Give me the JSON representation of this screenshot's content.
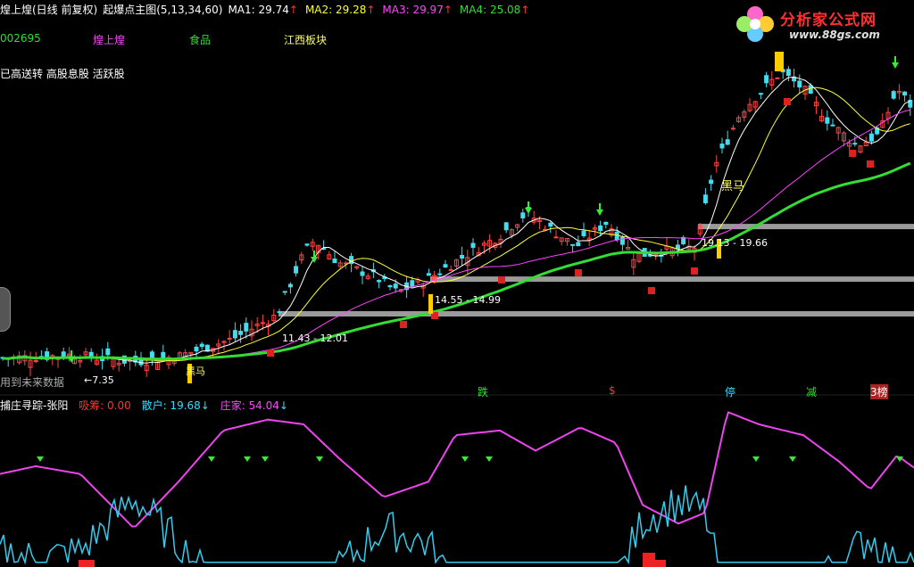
{
  "header": {
    "title": "煌上煌(日线 前复权)",
    "indicator": "起爆点主图(5,13,34,60)",
    "ma1": "MA1: 29.74",
    "ma2": "MA2: 29.28",
    "ma3": "MA3: 29.97",
    "ma4": "MA4: 25.08",
    "ma1_color": "#ffffff",
    "ma2_color": "#ffff33",
    "ma3_color": "#ff44ff",
    "ma4_color": "#33dd33"
  },
  "info": {
    "code": "002695",
    "name": "煌上煌",
    "industry": "食品",
    "region": "江西板块",
    "tags": "已高送转 高股息股 活跃股"
  },
  "logo": {
    "text": "分析家公式网",
    "url": "www.88gs.com"
  },
  "sub_header": {
    "title": "捕庄寻踪-张阳",
    "s1": "吸筹: 0.00",
    "s2": "散户: 19.68",
    "s3": "庄家: 54.04",
    "s1_color": "#ff3333",
    "s2_color": "#33ddff",
    "s3_color": "#ff44ff"
  },
  "annotations": {
    "future": "用到未来数据",
    "low_price": "←7.35",
    "heima1": "黑马",
    "heima2": "黑马",
    "range1": "11.43 - 12.01",
    "range2": "14.55 - 14.99",
    "range3": "19.13 - 19.66",
    "sig_die": "跌",
    "sig_s": "$",
    "sig_ting": "停",
    "sig_jian": "减",
    "sig_bang": "3榜"
  },
  "chart_data": [
    {
      "type": "candlestick",
      "name": "main",
      "ylim": [
        6,
        35
      ],
      "ma_lines": [
        "MA1",
        "MA2",
        "MA3",
        "MA4"
      ],
      "ma_last": [
        29.74,
        29.28,
        29.97,
        25.08
      ],
      "support_levels": [
        {
          "low": 11.43,
          "high": 12.01
        },
        {
          "low": 14.55,
          "high": 14.99
        },
        {
          "low": 19.13,
          "high": 19.66
        }
      ],
      "low_marker": 7.35
    },
    {
      "type": "line",
      "name": "sub",
      "series": [
        {
          "name": "散户",
          "last": 19.68
        },
        {
          "name": "庄家",
          "last": 54.04
        },
        {
          "name": "吸筹",
          "last": 0.0
        }
      ]
    }
  ]
}
